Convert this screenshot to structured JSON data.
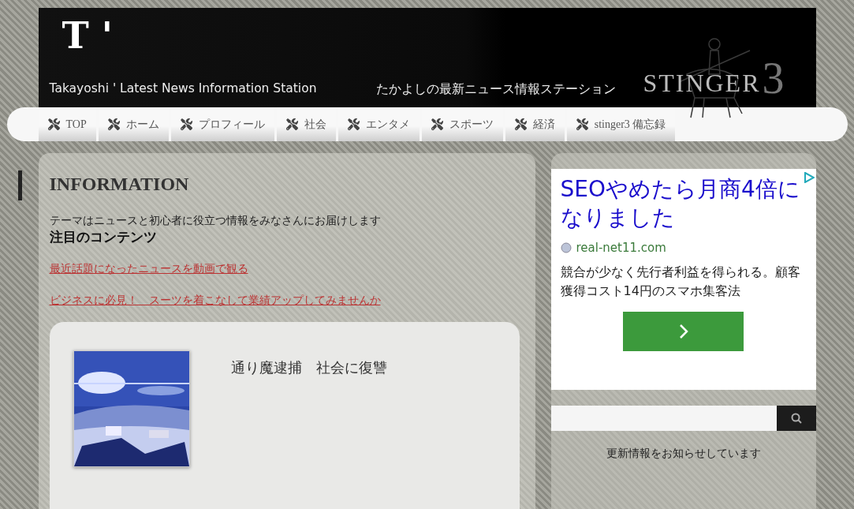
{
  "header": {
    "logo": "T '",
    "tagline_en": "Takayoshi ' Latest News Information Station",
    "tagline_ja": "たかよしの最新ニュース情報ステーション",
    "brand": "STINGER",
    "brand_number": "3"
  },
  "nav": [
    {
      "label": "TOP"
    },
    {
      "label": "ホーム"
    },
    {
      "label": "プロフィール"
    },
    {
      "label": "社会"
    },
    {
      "label": "エンタメ"
    },
    {
      "label": "スポーツ"
    },
    {
      "label": "経済"
    },
    {
      "label": "stinger3 備忘録"
    }
  ],
  "main": {
    "heading": "INFORMATION",
    "intro": "テーマはニュースと初心者に役立つ情報をみなさんにお届けします",
    "subheading": "注目のコンテンツ",
    "links": [
      "最近話題になったニュースを動画で観る",
      "ビジネスに必見！　スーツを着こなして業績アップしてみませんか"
    ],
    "article": {
      "title": "通り魔逮捕　社会に復讐"
    }
  },
  "sidebar": {
    "ad": {
      "title": "SEOやめたら月商4倍になりました",
      "url": "real-net11.com",
      "description": "競合が少なく先行者利益を得られる。顧客獲得コスト14円のスマホ集客法"
    },
    "notice": "更新情報をお知らせしています"
  }
}
